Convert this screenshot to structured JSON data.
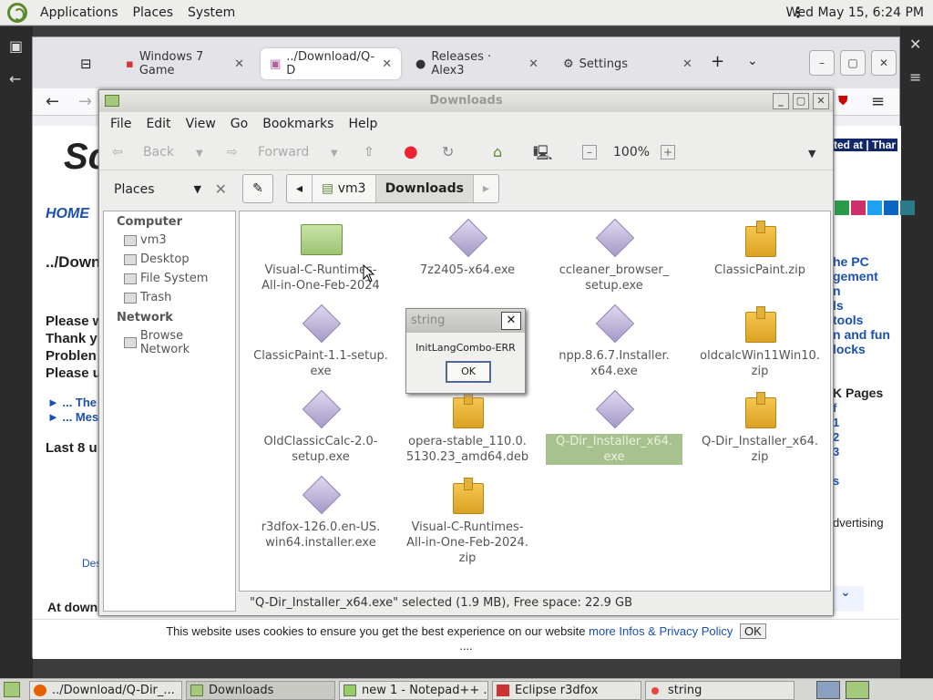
{
  "topbar": {
    "menus": [
      "Applications",
      "Places",
      "System"
    ],
    "clock": "Wed May 15,  6:24 PM"
  },
  "browser": {
    "tabs": [
      {
        "label": "Windows 7 Game",
        "color": "#d33"
      },
      {
        "label": "../Download/Q-D",
        "color": "#b65fa5"
      },
      {
        "label": "Releases · Alex3",
        "color": "#333"
      },
      {
        "label": "Settings",
        "color": "#555"
      }
    ],
    "page": {
      "home": "HOME",
      "heading": "../Down",
      "lines": [
        "Please w",
        "Thank y",
        "Problen",
        "Please u"
      ],
      "links": [
        "► ... The",
        "► ... Mes"
      ],
      "last8": "Last 8 u",
      "right": [
        "ted at | Thar",
        "he PC",
        "gement",
        "n",
        "ls",
        "tools",
        "n and fun",
        "locks",
        "K Pages",
        "f",
        "1",
        "2",
        "3",
        "s",
        "dvertising"
      ],
      "bottom_left": "At down",
      "des": "Des"
    },
    "cookie": {
      "text": "This website uses cookies to ensure you get the best experience on our website",
      "link": "more Infos & Privacy Policy",
      "ok": "OK",
      "more": "...."
    }
  },
  "fm": {
    "title": "Downloads",
    "menu": [
      "File",
      "Edit",
      "View",
      "Go",
      "Bookmarks",
      "Help"
    ],
    "tools": {
      "back": "Back",
      "forward": "Forward",
      "zoom": "100%"
    },
    "places_label": "Places",
    "crumbs": [
      "vm3",
      "Downloads"
    ],
    "sidebar": {
      "computer": "Computer",
      "computer_items": [
        "vm3",
        "Desktop",
        "File System",
        "Trash"
      ],
      "network": "Network",
      "network_items": [
        "Browse Network"
      ]
    },
    "files": [
      {
        "name": "Visual-C-Runtimes-All-in-One-Feb-2024",
        "kind": "folder"
      },
      {
        "name": "7z2405-x64.exe",
        "kind": "exe"
      },
      {
        "name": "ccleaner_browser_setup.exe",
        "kind": "exe"
      },
      {
        "name": "ClassicPaint.zip",
        "kind": "zip"
      },
      {
        "name": "ClassicPaint-1.1-setup.exe",
        "kind": "exe"
      },
      {
        "name": "",
        "kind": "none"
      },
      {
        "name": "npp.8.6.7.Installer.x64.exe",
        "kind": "exe"
      },
      {
        "name": "oldcalcWin11Win10.zip",
        "kind": "zip"
      },
      {
        "name": "OldClassicCalc-2.0-setup.exe",
        "kind": "exe"
      },
      {
        "name": "opera-stable_110.0.5130.23_amd64.deb",
        "kind": "zip"
      },
      {
        "name": "Q-Dir_Installer_x64.exe",
        "kind": "exe",
        "selected": true
      },
      {
        "name": "Q-Dir_Installer_x64.zip",
        "kind": "zip"
      },
      {
        "name": "r3dfox-126.0.en-US.win64.installer.exe",
        "kind": "exe"
      },
      {
        "name": "Visual-C-Runtimes-All-in-One-Feb-2024.zip",
        "kind": "zip"
      }
    ],
    "file_lines": [
      [
        "Visual-C-Runtimes-",
        "All-in-One-Feb-2024"
      ],
      [
        "7z2405-x64.exe"
      ],
      [
        "ccleaner_browser_",
        "setup.exe"
      ],
      [
        "ClassicPaint.zip"
      ],
      [
        "ClassicPaint-1.1-setup.",
        "exe"
      ],
      [],
      [
        "npp.8.6.7.Installer.",
        "x64.exe"
      ],
      [
        "oldcalcWin11Win10.",
        "zip"
      ],
      [
        "OldClassicCalc-2.0-",
        "setup.exe"
      ],
      [
        "opera-stable_110.0.",
        "5130.23_amd64.deb"
      ],
      [
        "Q-Dir_Installer_x64.",
        "exe"
      ],
      [
        "Q-Dir_Installer_x64.",
        "zip"
      ],
      [
        "r3dfox-126.0.en-US.",
        "win64.installer.exe"
      ],
      [
        "Visual-C-Runtimes-",
        "All-in-One-Feb-2024.",
        "zip"
      ]
    ],
    "status": "\"Q-Dir_Installer_x64.exe\" selected (1.9 MB), Free space: 22.9 GB"
  },
  "dialog": {
    "title": "string",
    "message": "InitLangCombo-ERR",
    "ok": "OK"
  },
  "taskbar": [
    "../Download/Q-Dir_...",
    "Downloads",
    "new 1 - Notepad++ ...",
    "Eclipse r3dfox",
    "string"
  ]
}
